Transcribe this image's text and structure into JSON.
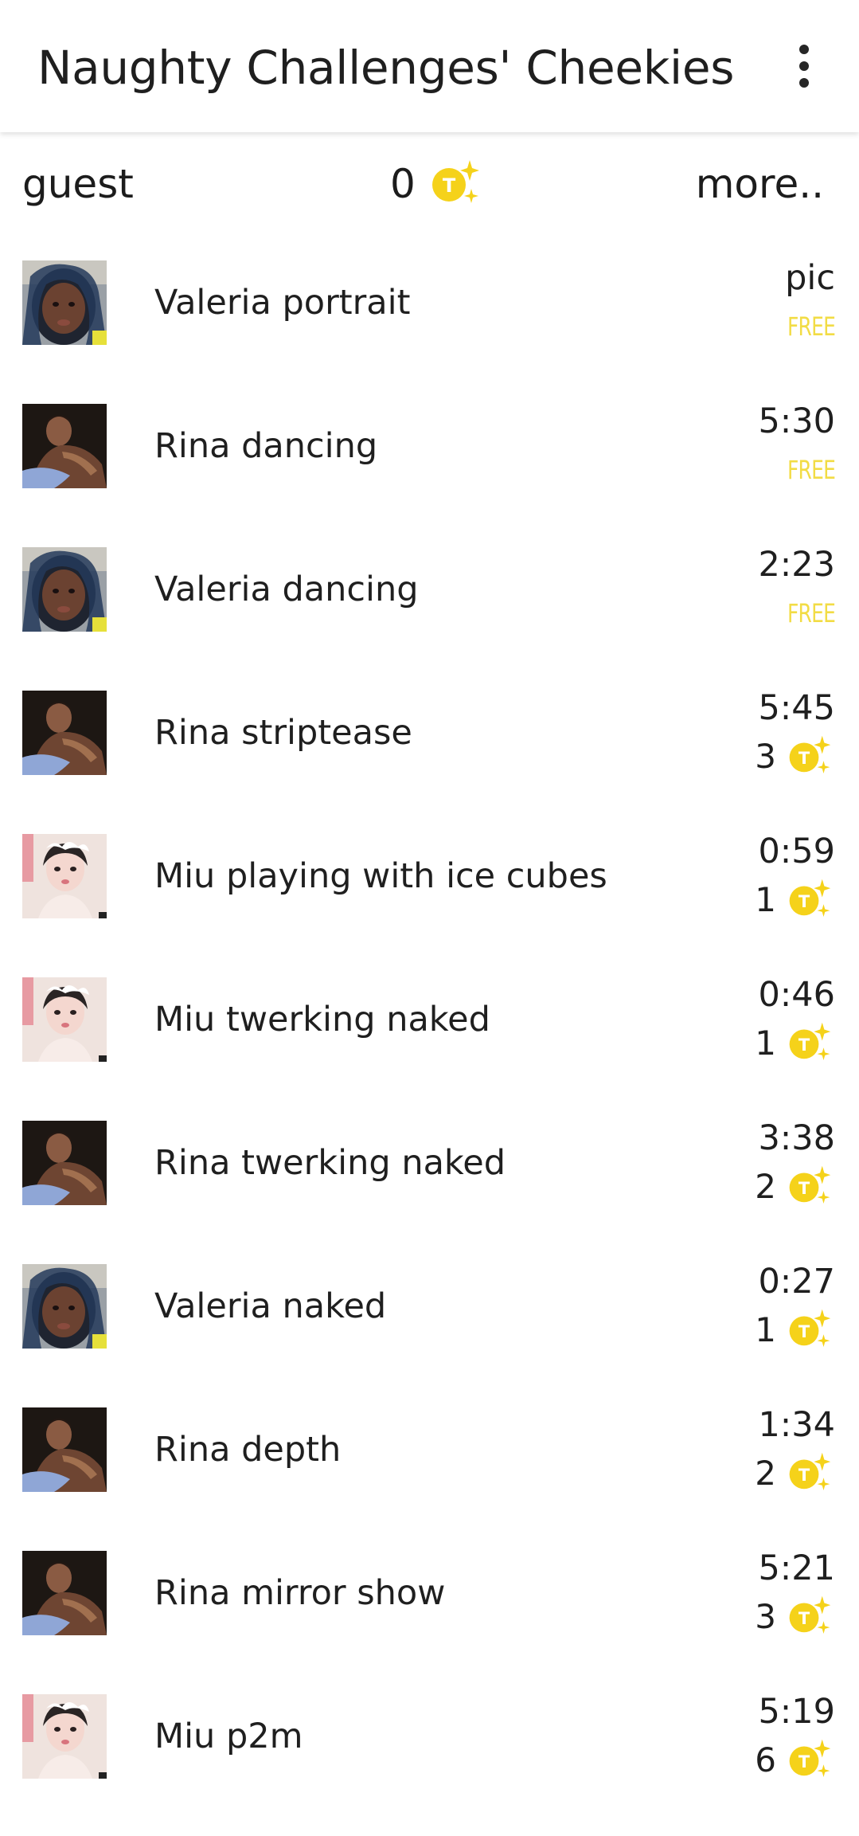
{
  "appbar": {
    "title": "Naughty Challenges' Cheekies",
    "menu_icon": "more-vert-icon"
  },
  "status": {
    "user": "guest",
    "balance": "0",
    "more": "more.."
  },
  "colors": {
    "coin": "#f5d21a",
    "free": "#f2dc45",
    "text": "#1f1f1f"
  },
  "items": [
    {
      "title": "Valeria portrait",
      "duration": "pic",
      "price": "FREE",
      "free": true,
      "avatar": "valeria"
    },
    {
      "title": "Rina dancing",
      "duration": "5:30",
      "price": "FREE",
      "free": true,
      "avatar": "rina"
    },
    {
      "title": "Valeria dancing",
      "duration": "2:23",
      "price": "FREE",
      "free": true,
      "avatar": "valeria"
    },
    {
      "title": "Rina striptease",
      "duration": "5:45",
      "price": "3",
      "free": false,
      "avatar": "rina"
    },
    {
      "title": "Miu playing with ice cubes",
      "duration": "0:59",
      "price": "1",
      "free": false,
      "avatar": "miu"
    },
    {
      "title": "Miu twerking naked",
      "duration": "0:46",
      "price": "1",
      "free": false,
      "avatar": "miu"
    },
    {
      "title": "Rina twerking naked",
      "duration": "3:38",
      "price": "2",
      "free": false,
      "avatar": "rina"
    },
    {
      "title": "Valeria naked",
      "duration": "0:27",
      "price": "1",
      "free": false,
      "avatar": "valeria"
    },
    {
      "title": "Rina depth",
      "duration": "1:34",
      "price": "2",
      "free": false,
      "avatar": "rina"
    },
    {
      "title": "Rina mirror show",
      "duration": "5:21",
      "price": "3",
      "free": false,
      "avatar": "rina"
    },
    {
      "title": "Miu p2m",
      "duration": "5:19",
      "price": "6",
      "free": false,
      "avatar": "miu"
    }
  ]
}
